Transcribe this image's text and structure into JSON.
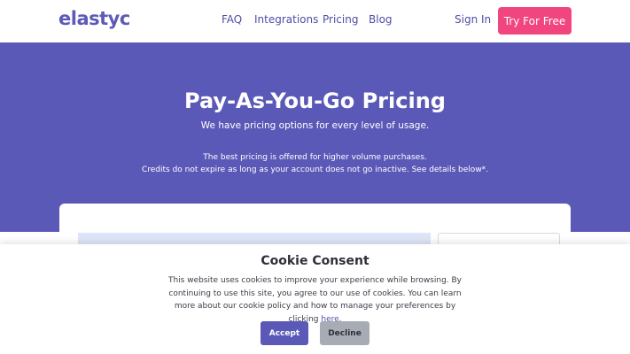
{
  "header": {
    "logo": "elastyc",
    "nav": [
      "FAQ",
      "Integrations",
      "Pricing",
      "Blog"
    ],
    "sign_in": "Sign In",
    "cta": "Try For Free"
  },
  "hero": {
    "title": "Pay-As-You-Go Pricing",
    "subtitle": "We have pricing options for every level of usage.",
    "note_line1": "The best pricing is offered for higher volume purchases.",
    "note_line2": "Credits do not expire as long as your account does not go inactive. See details below*."
  },
  "cookie": {
    "title": "Cookie Consent",
    "text": "This website uses cookies to improve your experience while browsing. By continuing to use this site, you agree to our use of cookies. You can learn more about our cookie policy and how to manage your preferences by clicking",
    "link": "here",
    "accept": "Accept",
    "decline": "Decline"
  },
  "colors": {
    "brand": "#5b59b7",
    "accent": "#f0457e",
    "panel": "#dde5f8"
  }
}
